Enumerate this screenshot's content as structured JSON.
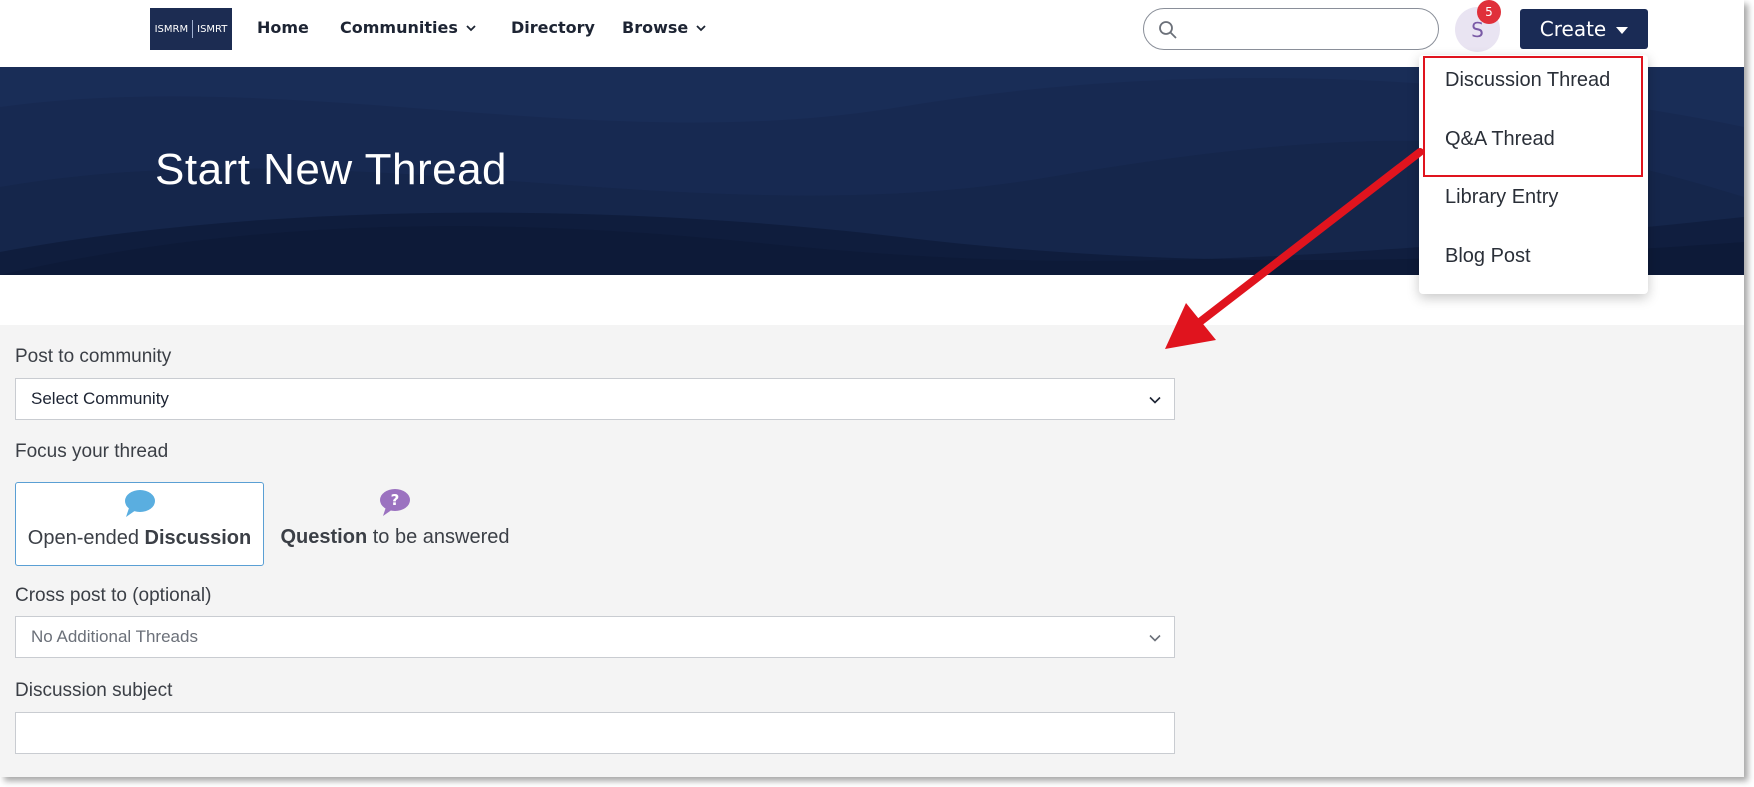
{
  "header": {
    "logo_left": "ISMRM",
    "logo_right": "ISMRT",
    "nav": [
      {
        "label": "Home"
      },
      {
        "label": "Communities"
      },
      {
        "label": "Directory"
      },
      {
        "label": "Browse"
      }
    ],
    "search_placeholder": "",
    "avatar_initial": "S",
    "notification_count": "5",
    "create_label": "Create"
  },
  "create_menu": {
    "items": [
      {
        "label": "Discussion Thread"
      },
      {
        "label": "Q&A Thread"
      },
      {
        "label": "Library Entry"
      },
      {
        "label": "Blog Post"
      }
    ]
  },
  "banner": {
    "title": "Start New Thread"
  },
  "form": {
    "community_label": "Post to community",
    "community_value": "Select Community",
    "focus_label": "Focus your thread",
    "focus_options": [
      {
        "prefix": "Open-ended ",
        "bold": "Discussion",
        "suffix": ""
      },
      {
        "prefix": "",
        "bold": "Question",
        "suffix": " to be answered"
      }
    ],
    "crosspost_label": "Cross post to (optional)",
    "crosspost_value": "No Additional Threads",
    "subject_label": "Discussion subject",
    "subject_value": ""
  },
  "colors": {
    "brand_navy": "#1a2b55",
    "banner_bg": "#15264b",
    "highlight_red": "#e0141e",
    "badge_red": "#e0303a",
    "discussion_icon": "#5aaee0",
    "question_icon": "#9b72c0"
  },
  "icons": {
    "search": "magnifier-icon",
    "dropdown": "chevron-down-icon",
    "discussion": "speech-bubble-icon",
    "question": "question-bubble-icon"
  }
}
